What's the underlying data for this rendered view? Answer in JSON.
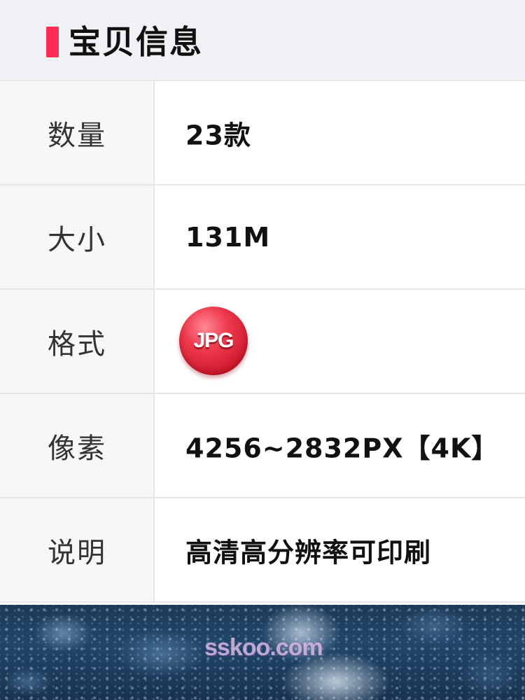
{
  "header": {
    "title": "宝贝信息",
    "accent_color": "#ff2d55"
  },
  "rows": [
    {
      "label": "数量",
      "value": "23款"
    },
    {
      "label": "大小",
      "value": "131M"
    },
    {
      "label": "格式",
      "value": "JPG"
    },
    {
      "label": "像素",
      "value": "4256~2832PX【4K】"
    },
    {
      "label": "说明",
      "value": "高清高分辨率可印刷"
    }
  ],
  "format_badge": {
    "text": "JPG",
    "color": "#e02a3c",
    "icon": "jpg-badge-icon"
  },
  "photo": {
    "watermark": "sskoo.com"
  }
}
